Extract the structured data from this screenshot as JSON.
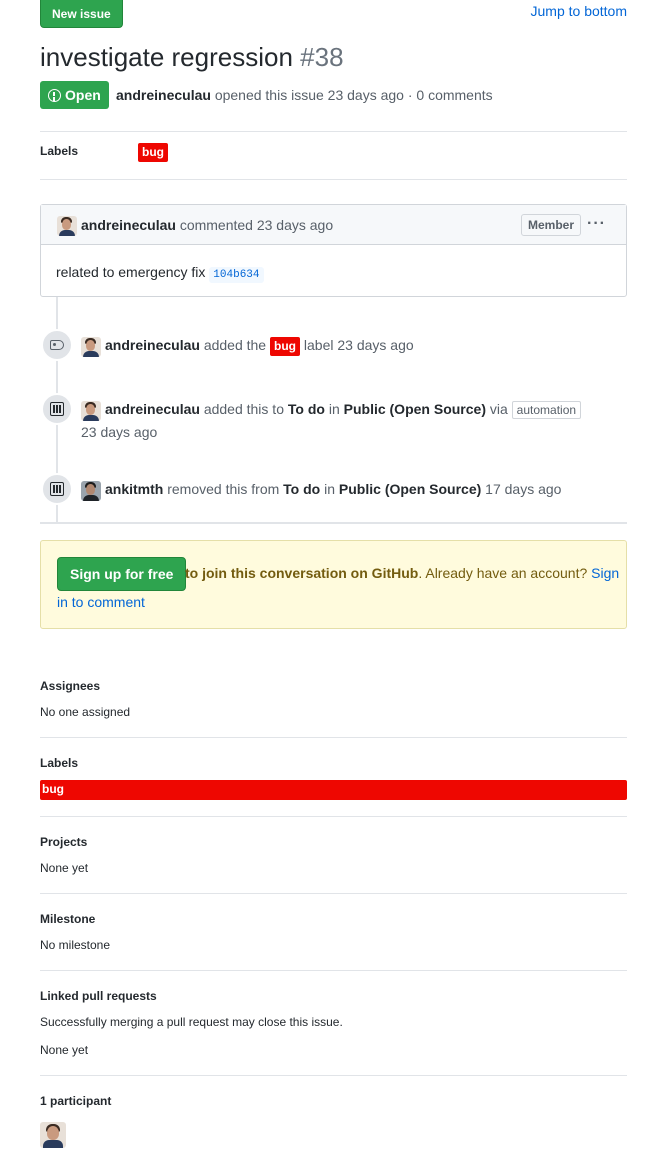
{
  "header": {
    "new_issue_label": "New issue",
    "jump_label": "Jump to bottom",
    "title": "investigate regression",
    "number": "#38"
  },
  "status": {
    "state": "Open",
    "author": "andreineculau",
    "opened_text": "opened this issue 23 days ago · 0 comments"
  },
  "labels_row": {
    "title": "Labels",
    "label": "bug"
  },
  "comment": {
    "author": "andreineculau",
    "action": "commented 23 days ago",
    "role": "Member",
    "menu": "···",
    "body_text": "related to emergency fix",
    "sha": "104b634"
  },
  "timeline": [
    {
      "actor": "andreineculau",
      "pre": "added the",
      "label": "bug",
      "post": "label 23 days ago"
    },
    {
      "actor": "andreineculau",
      "pre": "added this to",
      "column": "To do",
      "in": "in",
      "project": "Public (Open Source)",
      "via": "via",
      "tag": "automation",
      "time": "23 days ago"
    },
    {
      "actor": "ankitmth",
      "pre": "removed this from",
      "column": "To do",
      "in": "in",
      "project": "Public (Open Source)",
      "time": "17 days ago"
    }
  ],
  "signup": {
    "button": "Sign up for free",
    "bold_text": "to join this conversation on GitHub",
    "rest_text": ". Already have an account?",
    "link_a": "Sign",
    "link_b": "in to comment"
  },
  "sidebar": {
    "assignees_title": "Assignees",
    "assignees_value": "No one assigned",
    "labels_title": "Labels",
    "labels_value": "bug",
    "projects_title": "Projects",
    "projects_value": "None yet",
    "milestone_title": "Milestone",
    "milestone_value": "No milestone",
    "linked_title": "Linked pull requests",
    "linked_desc": "Successfully merging a pull request may close this issue.",
    "linked_value": "None yet",
    "participants_title": "1 participant"
  },
  "colors": {
    "green": "#2ea44f",
    "bug_red": "#ee0701",
    "link_blue": "#0366d6",
    "banner_bg": "#fffbdd"
  }
}
